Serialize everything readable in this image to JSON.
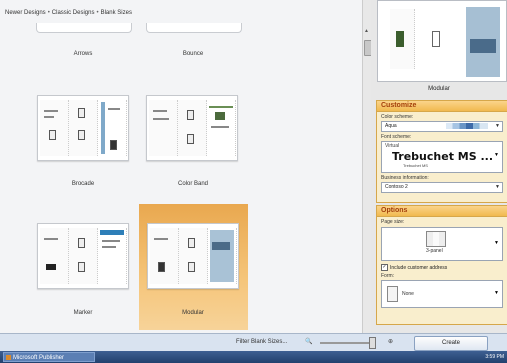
{
  "breadcrumb": [
    "Newer Designs",
    "Classic Designs",
    "Blank Sizes"
  ],
  "designs": [
    {
      "label": "Arrows"
    },
    {
      "label": "Bounce"
    },
    {
      "label": "Brocade"
    },
    {
      "label": "Color Band"
    },
    {
      "label": "Marker"
    },
    {
      "label": "Modular",
      "selected": true
    }
  ],
  "preview": {
    "label": "Modular"
  },
  "customize": {
    "title": "Customize",
    "color_scheme_label": "Color scheme:",
    "color_scheme_value": "Aqua",
    "font_scheme_label": "Font scheme:",
    "font_scheme_name": "Virtual",
    "font_scheme_heading": "Trebuchet MS ...",
    "font_scheme_body": "Trebuchet MS",
    "business_info_label": "Business information:",
    "business_info_value": "Contoso 2"
  },
  "options": {
    "title": "Options",
    "page_size_label": "Page size:",
    "page_size_value": "3-panel",
    "include_address_label": "Include customer address",
    "include_address_checked": true,
    "form_label": "Form:",
    "form_value": "None"
  },
  "bottom_bar": {
    "filter_label": "Filter Blank Sizes...",
    "create_label": "Create"
  },
  "taskbar": {
    "app_label": "Microsoft Publisher",
    "clock": "3:59 PM"
  },
  "colors": {
    "accent": "#f1b94f",
    "selection": "#f5c57a",
    "taskbar": "#2c4b7b"
  }
}
